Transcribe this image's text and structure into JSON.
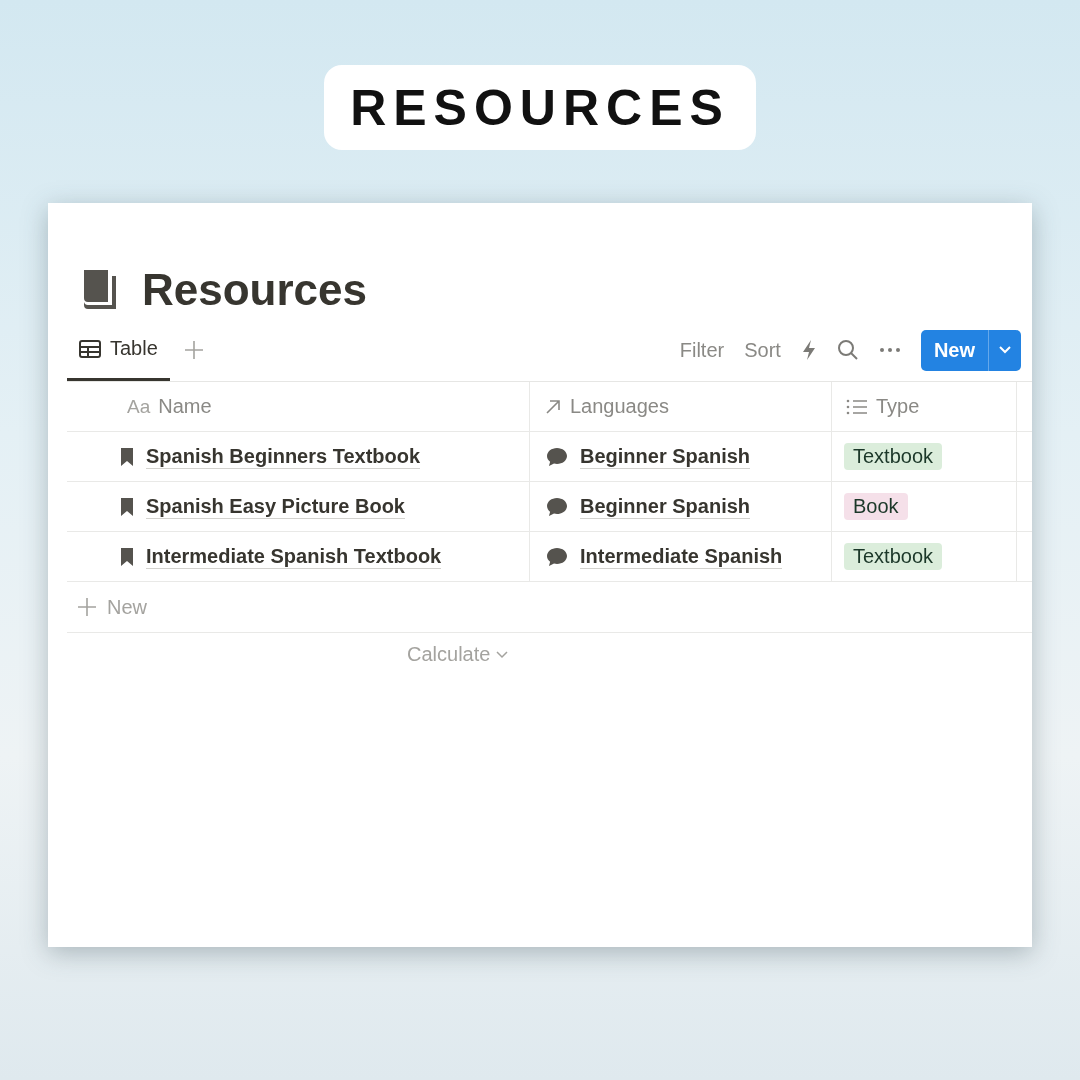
{
  "banner": {
    "title": "RESOURCES"
  },
  "page": {
    "title": "Resources"
  },
  "views": [
    {
      "label": "Table",
      "selected": true
    }
  ],
  "toolbar": {
    "filter": "Filter",
    "sort": "Sort",
    "new_button": "New"
  },
  "table": {
    "columns": [
      {
        "label": "Name",
        "kind": "title",
        "icon_text": "Aa"
      },
      {
        "label": "Languages",
        "kind": "relation"
      },
      {
        "label": "Type",
        "kind": "select"
      }
    ],
    "rows": [
      {
        "name": "Spanish Beginners Textbook",
        "languages": "Beginner Spanish",
        "type": {
          "label": "Textbook",
          "color": "#dbeddb"
        }
      },
      {
        "name": "Spanish Easy Picture Book",
        "languages": "Beginner Spanish",
        "type": {
          "label": "Book",
          "color": "#f5e0e9"
        }
      },
      {
        "name": "Intermediate Spanish Textbook",
        "languages": "Intermediate Spanish",
        "type": {
          "label": "Textbook",
          "color": "#dbeddb"
        }
      }
    ]
  },
  "new_row": "New",
  "calculate": "Calculate"
}
